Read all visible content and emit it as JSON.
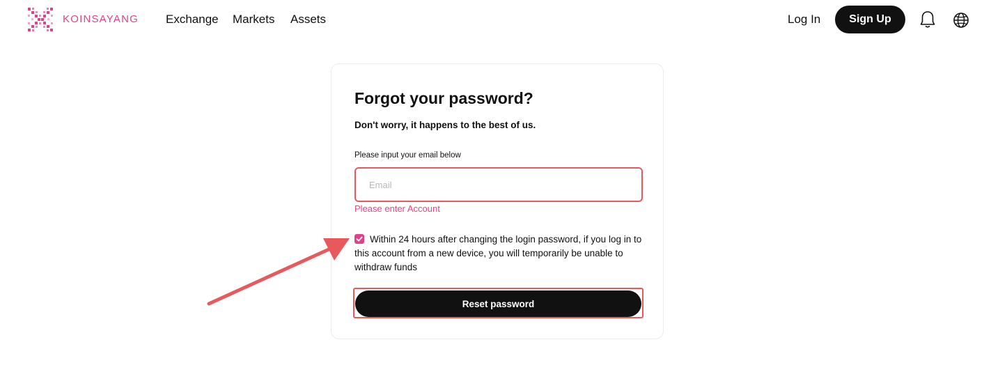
{
  "header": {
    "brand": "KOINSAYANG",
    "nav": [
      {
        "label": "Exchange"
      },
      {
        "label": "Markets"
      },
      {
        "label": "Assets"
      }
    ],
    "login_label": "Log In",
    "signup_label": "Sign Up",
    "icons": [
      "bell-icon",
      "globe-icon"
    ]
  },
  "form": {
    "title": "Forgot your password?",
    "subtitle": "Don't worry, it happens to the best of us.",
    "email_label": "Please input your email below",
    "email_placeholder": "Email",
    "email_value": "",
    "error": "Please enter Account",
    "notice_checked": true,
    "notice": "Within 24 hours after changing the login password, if you log in to this account from a new device, you will temporarily be unable to withdraw funds",
    "reset_label": "Reset password"
  },
  "colors": {
    "accent": "#e0428a",
    "error": "#e8447c",
    "highlight": "#e8595e",
    "button": "#111111"
  }
}
